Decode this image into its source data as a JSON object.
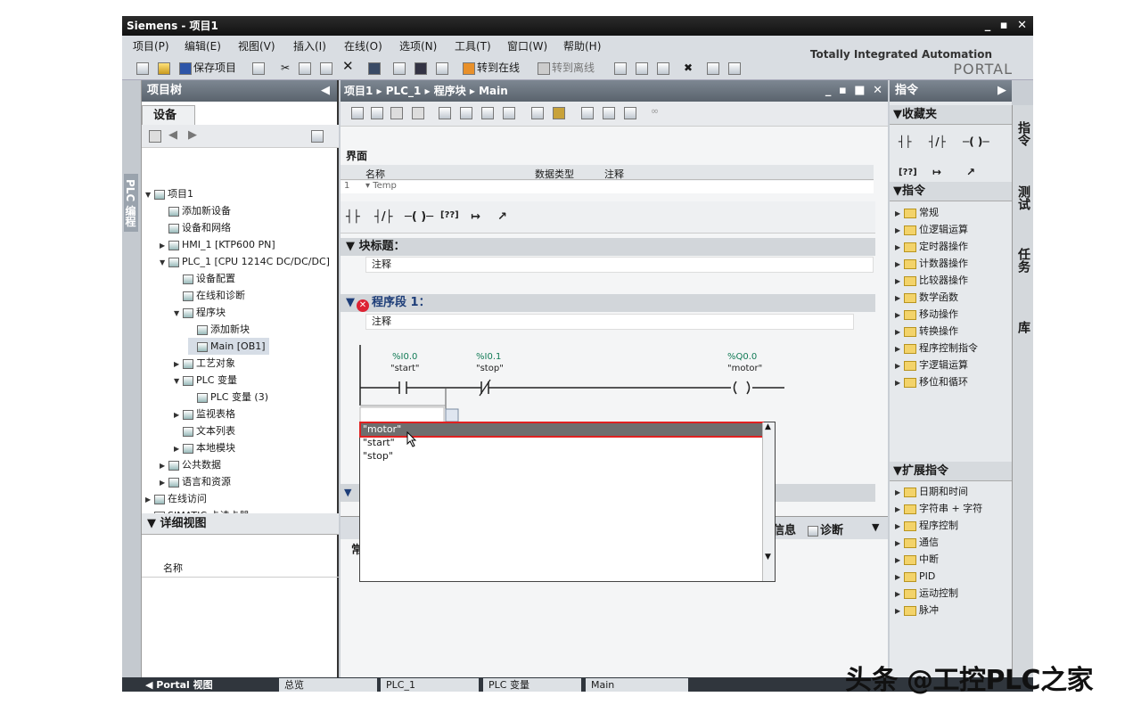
{
  "app": {
    "title": "Siemens  -  项目1",
    "window_controls": "_ ▪ ✕",
    "brand_line1": "Totally Integrated Automation",
    "brand_line2": "PORTAL"
  },
  "menu": [
    "项目(P)",
    "编辑(E)",
    "视图(V)",
    "插入(I)",
    "在线(O)",
    "选项(N)",
    "工具(T)",
    "窗口(W)",
    "帮助(H)"
  ],
  "toolbar": {
    "save": "保存项目",
    "go_online": "转到在线",
    "go_offline": "转到离线"
  },
  "left_vtab": "PLC 编程",
  "project_tree": {
    "title": "项目树",
    "device_tab": "设备",
    "items": [
      {
        "label": "项目1",
        "indent": 0,
        "expanded": "▼"
      },
      {
        "label": "添加新设备",
        "indent": 1,
        "expanded": ""
      },
      {
        "label": "设备和网络",
        "indent": 1,
        "expanded": ""
      },
      {
        "label": "HMI_1 [KTP600 PN]",
        "indent": 1,
        "expanded": "▶"
      },
      {
        "label": "PLC_1 [CPU 1214C DC/DC/DC]",
        "indent": 1,
        "expanded": "▼"
      },
      {
        "label": "设备配置",
        "indent": 2,
        "expanded": ""
      },
      {
        "label": "在线和诊断",
        "indent": 2,
        "expanded": ""
      },
      {
        "label": "程序块",
        "indent": 2,
        "expanded": "▼"
      },
      {
        "label": "添加新块",
        "indent": 3,
        "expanded": ""
      },
      {
        "label": "Main [OB1]",
        "indent": 3,
        "expanded": ""
      },
      {
        "label": "工艺对象",
        "indent": 2,
        "expanded": "▶"
      },
      {
        "label": "PLC 变量",
        "indent": 2,
        "expanded": "▼"
      },
      {
        "label": "PLC 变量 (3)",
        "indent": 3,
        "expanded": ""
      },
      {
        "label": "监视表格",
        "indent": 2,
        "expanded": "▶"
      },
      {
        "label": "文本列表",
        "indent": 2,
        "expanded": ""
      },
      {
        "label": "本地模块",
        "indent": 2,
        "expanded": "▶"
      },
      {
        "label": "公共数据",
        "indent": 1,
        "expanded": "▶"
      },
      {
        "label": "语言和资源",
        "indent": 1,
        "expanded": "▶"
      },
      {
        "label": "在线访问",
        "indent": 0,
        "expanded": "▶"
      },
      {
        "label": "SIMATIC 卡读卡器",
        "indent": 0,
        "expanded": "▶"
      }
    ]
  },
  "detail_view": {
    "title": "详细视图",
    "column": "名称"
  },
  "editor": {
    "breadcrumb": "项目1  ▸  PLC_1  ▸  程序块  ▸  Main",
    "window_controls": "_ ▪ ■ ✕",
    "interface_label": "界面",
    "interface_columns": [
      "名称",
      "数据类型",
      "注释"
    ],
    "interface_row": "Temp",
    "interface_row_no": "1",
    "block_title": "块标题：",
    "block_comment": "注释",
    "segment_title": "程序段 1：",
    "segment_comment": "注释",
    "ladder": {
      "contact1_addr": "%I0.0",
      "contact1_tag": "\"start\"",
      "contact2_addr": "%I0.1",
      "contact2_tag": "\"stop\"",
      "coil_addr": "%Q0.0",
      "coil_tag": "\"motor\""
    },
    "bottom_tabs": [
      "信息",
      "诊断"
    ],
    "bottom_partial": "常"
  },
  "autocomplete": {
    "selected": "\"motor\"",
    "items": [
      "\"start\"",
      "\"stop\""
    ]
  },
  "instructions": {
    "title": "指令",
    "favorites_title": "收藏夹",
    "favorites_symbols": [
      "┤├",
      "┤/├",
      "─( )─",
      "[??]",
      "↦",
      "↗"
    ],
    "section_title": "指令",
    "items": [
      "常规",
      "位逻辑运算",
      "定时器操作",
      "计数器操作",
      "比较器操作",
      "数学函数",
      "移动操作",
      "转换操作",
      "程序控制指令",
      "字逻辑运算",
      "移位和循环"
    ],
    "ext_title": "扩展指令",
    "ext_items": [
      "日期和时间",
      "字符串 + 字符",
      "程序控制",
      "通信",
      "中断",
      "PID",
      "运动控制",
      "脉冲"
    ]
  },
  "right_vtabs": [
    "指令",
    "测试",
    "任务",
    "库"
  ],
  "taskbar": [
    "Portal 视图",
    "总览",
    "PLC_1",
    "PLC 变量",
    "Main"
  ],
  "watermark": "头条 @工控PLC之家"
}
